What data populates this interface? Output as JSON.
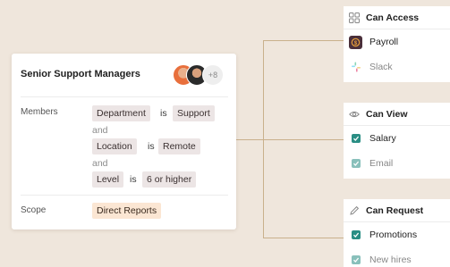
{
  "group_card": {
    "title": "Senior Support Managers",
    "more_count": "+8",
    "members_label": "Members",
    "conditions": [
      {
        "field": "Department",
        "operator": "is",
        "value": "Support"
      },
      {
        "connector": "and"
      },
      {
        "field": "Location",
        "operator": "is",
        "value": "Remote"
      },
      {
        "connector": "and"
      },
      {
        "field": "Level",
        "operator": "is",
        "value": "6 or higher"
      }
    ],
    "scope_label": "Scope",
    "scope_value": "Direct Reports"
  },
  "panels": {
    "can_access": {
      "title": "Can Access",
      "items": [
        "Payroll",
        "Slack"
      ]
    },
    "can_view": {
      "title": "Can View",
      "items": [
        "Salary",
        "Email"
      ]
    },
    "can_request": {
      "title": "Can Request",
      "items": [
        "Promotions",
        "New hires"
      ]
    }
  },
  "colors": {
    "background": "#efe6dc",
    "connector": "#c9b08c",
    "check": "#2a8e84",
    "payroll_icon": "#4a2f3a"
  },
  "icons": [
    "grid-icon",
    "payroll-icon",
    "slack-icon",
    "eye-icon",
    "pencil-icon",
    "checkbox-icon",
    "avatar"
  ]
}
